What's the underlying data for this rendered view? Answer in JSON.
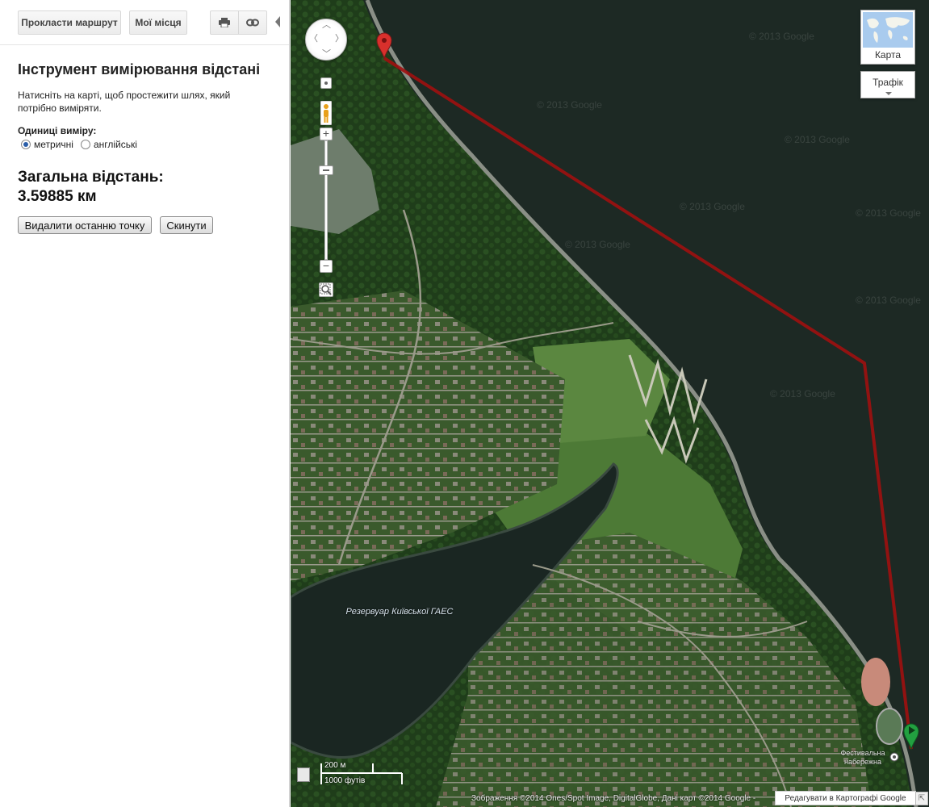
{
  "toolbar": {
    "route_label": "Прокласти маршрут",
    "places_label": "Мої місця"
  },
  "panel": {
    "title": "Інструмент вимірювання відстані",
    "instruction": "Натисніть на карті, щоб простежити шлях, який потрібно виміряти.",
    "units_label": "Одиниці виміру:",
    "unit_metric": "метричні",
    "unit_english": "англійські",
    "total_label": "Загальна відстань:",
    "total_value": "3.59885 км",
    "delete_last_label": "Видалити останню точку",
    "reset_label": "Скинути"
  },
  "map": {
    "map_type_label": "Карта",
    "traffic_label": "Трафік",
    "watermark": "© 2013 Google",
    "reservoir_label": "Резервуар Київської ГАЕС",
    "festival_label": "Фестивальна набережна",
    "scale_metric": "200 м",
    "scale_imperial": "1000 футів",
    "copyright": "Зображення ©2014 Ones/Spot Image, DigitalGlobe, Дані карт ©2014 Google -",
    "report_label": "Редагувати в Картографі Google",
    "path_color": "#a01010",
    "start_marker_color": "#d9302c",
    "end_marker_color": "#22a040"
  }
}
